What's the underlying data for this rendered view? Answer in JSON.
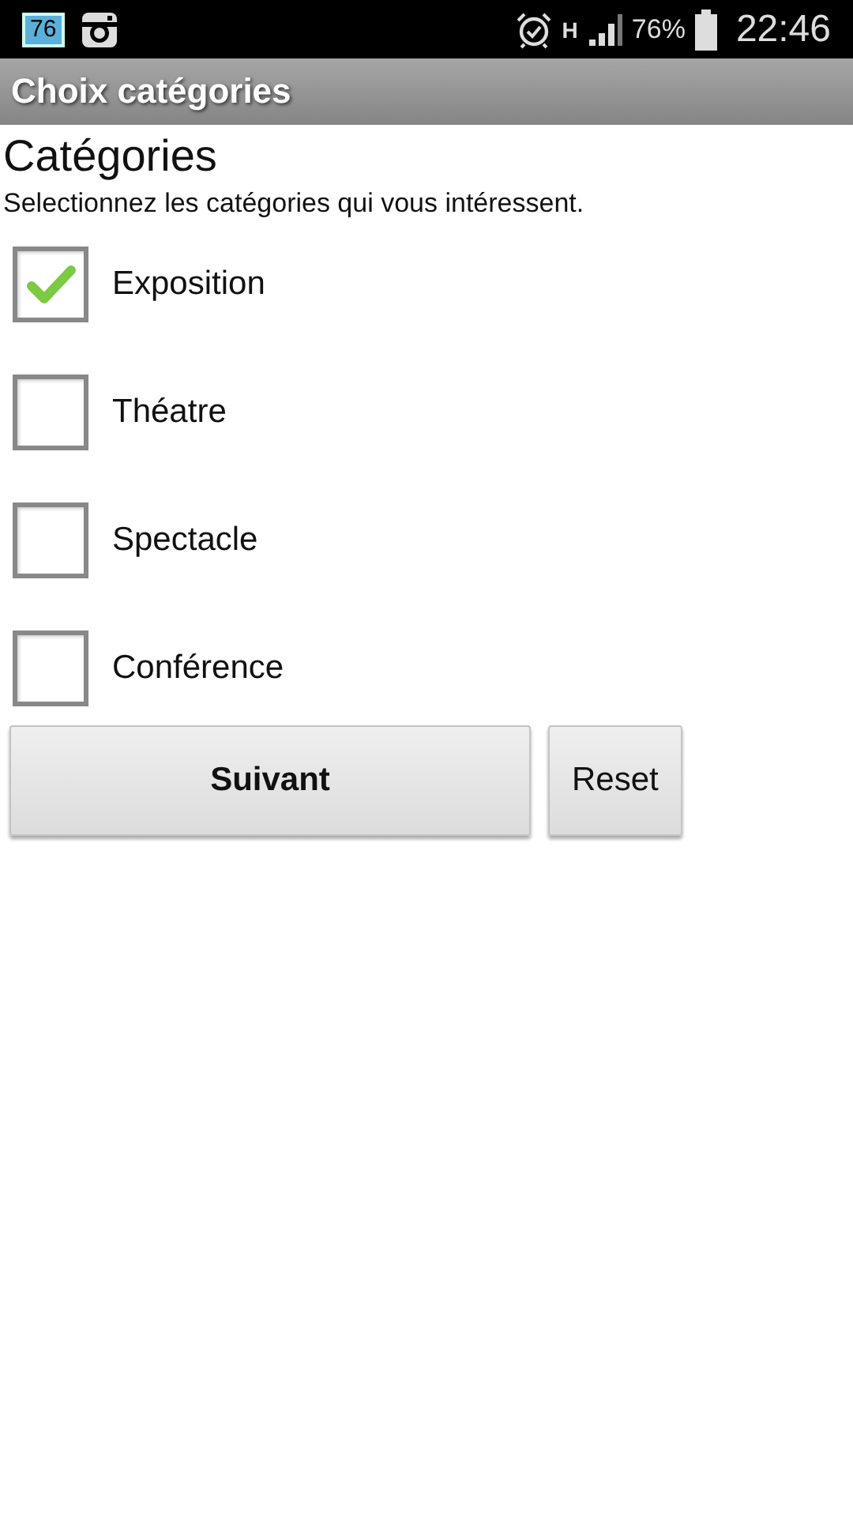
{
  "status_bar": {
    "notification_badge": "76",
    "network": "H",
    "battery_percent": "76%",
    "time": "22:46"
  },
  "action_bar": {
    "title": "Choix catégories"
  },
  "heading": "Catégories",
  "instruction": "Selectionnez les catégories qui vous intéressent.",
  "categories": [
    {
      "label": "Exposition",
      "checked": true
    },
    {
      "label": "Théatre",
      "checked": false
    },
    {
      "label": "Spectacle",
      "checked": false
    },
    {
      "label": "Conférence",
      "checked": false
    }
  ],
  "buttons": [
    {
      "label": "Suivant",
      "primary": true
    },
    {
      "label": "Reset",
      "primary": false
    }
  ]
}
